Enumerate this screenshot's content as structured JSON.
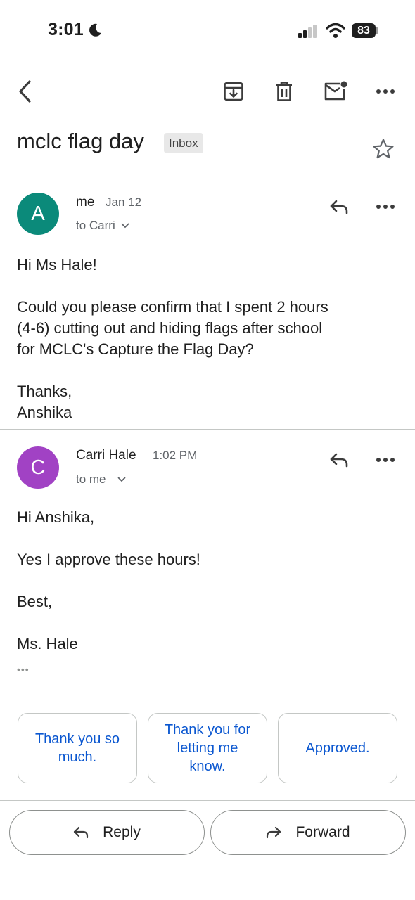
{
  "status_bar": {
    "time": "3:01",
    "battery": "83"
  },
  "subject": {
    "title": "mclc flag day",
    "label": "Inbox"
  },
  "messages": [
    {
      "avatar_letter": "A",
      "avatar_color": "#0b8a7a",
      "sender": "me",
      "date": "Jan 12",
      "recipient": "to Carri",
      "body": [
        "Hi Ms Hale!",
        "Could you please confirm that I spent 2 hours",
        "(4-6) cutting out and hiding flags after school",
        "for MCLC's Capture the Flag Day?",
        "Thanks,",
        "Anshika"
      ]
    },
    {
      "avatar_letter": "C",
      "avatar_color": "#a142c4",
      "sender": "Carri Hale",
      "date": "1:02 PM",
      "recipient": "to me",
      "body": [
        "Hi Anshika,",
        "Yes I approve these hours!",
        "Best,",
        "Ms. Hale"
      ],
      "trimmed_indicator": "•••"
    }
  ],
  "smart_replies": [
    "Thank you so much.",
    "Thank you for letting me know.",
    "Approved."
  ],
  "actions": {
    "reply": "Reply",
    "forward": "Forward"
  },
  "colors": {
    "accent": "#0b57d0",
    "text": "#1f1f1f",
    "secondary": "#5f6368"
  }
}
